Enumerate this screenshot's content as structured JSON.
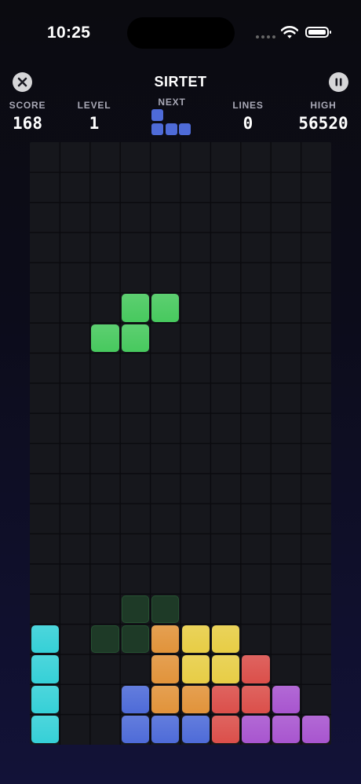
{
  "status_bar": {
    "time": "10:25"
  },
  "header": {
    "title": "SIRTET"
  },
  "stats": {
    "score_label": "SCORE",
    "score": "168",
    "level_label": "LEVEL",
    "level": "1",
    "next_label": "NEXT",
    "lines_label": "LINES",
    "lines": "0",
    "high_label": "HIGH",
    "high": "56520"
  },
  "next_piece": {
    "shape": "J",
    "color": "#4e6bd8",
    "cells": [
      [
        0,
        0
      ],
      [
        0,
        1
      ],
      [
        1,
        1
      ],
      [
        2,
        1
      ]
    ]
  },
  "board": {
    "columns": 10,
    "rows": 20,
    "active_piece": {
      "shape": "S",
      "color": "#47c95e",
      "cells": [
        [
          3,
          5
        ],
        [
          4,
          5
        ],
        [
          2,
          6
        ],
        [
          3,
          6
        ]
      ]
    },
    "ghost_piece": {
      "shape": "S",
      "color": "#1e3a27",
      "cells": [
        [
          3,
          15
        ],
        [
          4,
          15
        ],
        [
          2,
          16
        ],
        [
          3,
          16
        ]
      ]
    },
    "locked_cells": [
      {
        "col": 0,
        "row": 16,
        "color": "#35d0d7"
      },
      {
        "col": 4,
        "row": 16,
        "color": "#e1933a"
      },
      {
        "col": 5,
        "row": 16,
        "color": "#e7cd45"
      },
      {
        "col": 6,
        "row": 16,
        "color": "#e7cd45"
      },
      {
        "col": 0,
        "row": 17,
        "color": "#35d0d7"
      },
      {
        "col": 4,
        "row": 17,
        "color": "#e1933a"
      },
      {
        "col": 5,
        "row": 17,
        "color": "#e7cd45"
      },
      {
        "col": 6,
        "row": 17,
        "color": "#e7cd45"
      },
      {
        "col": 7,
        "row": 17,
        "color": "#db4f4a"
      },
      {
        "col": 0,
        "row": 18,
        "color": "#35d0d7"
      },
      {
        "col": 3,
        "row": 18,
        "color": "#4e6bd8"
      },
      {
        "col": 4,
        "row": 18,
        "color": "#e1933a"
      },
      {
        "col": 5,
        "row": 18,
        "color": "#e1933a"
      },
      {
        "col": 6,
        "row": 18,
        "color": "#db4f4a"
      },
      {
        "col": 7,
        "row": 18,
        "color": "#db4f4a"
      },
      {
        "col": 8,
        "row": 18,
        "color": "#a855cf"
      },
      {
        "col": 0,
        "row": 19,
        "color": "#35d0d7"
      },
      {
        "col": 3,
        "row": 19,
        "color": "#4e6bd8"
      },
      {
        "col": 4,
        "row": 19,
        "color": "#4e6bd8"
      },
      {
        "col": 5,
        "row": 19,
        "color": "#4e6bd8"
      },
      {
        "col": 6,
        "row": 19,
        "color": "#db4f4a"
      },
      {
        "col": 7,
        "row": 19,
        "color": "#a855cf"
      },
      {
        "col": 8,
        "row": 19,
        "color": "#a855cf"
      },
      {
        "col": 9,
        "row": 19,
        "color": "#a855cf"
      }
    ]
  }
}
